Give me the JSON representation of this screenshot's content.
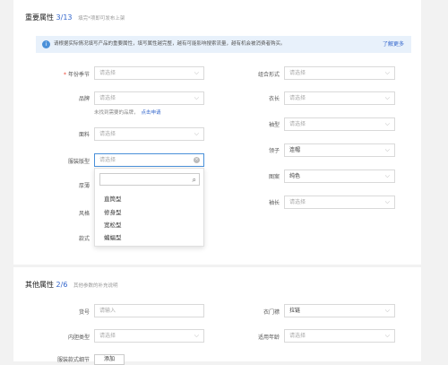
{
  "sections": {
    "important": {
      "title": "重要属性",
      "count": "3/13",
      "subtitle": "填完*项即可发布上架"
    },
    "other": {
      "title": "其他属性",
      "count": "2/6",
      "subtitle": "其他参数的补充说明"
    }
  },
  "notice": {
    "text": "请根据实际情况填写产品的重要属性，填写属性越完整，越有可能影响搜索流量，越有机会被消费者购买。",
    "more": "了解更多"
  },
  "placeholder": "请选择",
  "input_placeholder": "请输入",
  "fields_left": [
    {
      "label": "年份季节",
      "required": "*",
      "value": "请选择"
    },
    {
      "label": "品牌",
      "value": "请选择"
    },
    {
      "label": "面料",
      "value": "请选择"
    },
    {
      "label": "服装版型",
      "value": "请选择"
    },
    {
      "label": "厚薄",
      "value": ""
    },
    {
      "label": "风格",
      "value": ""
    },
    {
      "label": "款式",
      "value": ""
    }
  ],
  "brand_hint": {
    "text": "未找到需要的品牌，",
    "link": "点击申请"
  },
  "fields_right": [
    {
      "label": "组合形式",
      "value": "请选择"
    },
    {
      "label": "衣长",
      "value": "请选择"
    },
    {
      "label": "袖型",
      "value": "请选择"
    },
    {
      "label": "领子",
      "value": "连帽"
    },
    {
      "label": "图案",
      "value": "纯色"
    },
    {
      "label": "袖长",
      "value": "请选择"
    }
  ],
  "dropdown": {
    "options": [
      "直筒型",
      "修身型",
      "宽松型",
      "蝙蝠型"
    ]
  },
  "other_fields": [
    {
      "label": "货号",
      "value": "请输入"
    },
    {
      "label": "衣门襟",
      "value": "拉链"
    },
    {
      "label": "内胆类型",
      "value": "请选择"
    },
    {
      "label": "适用年龄",
      "value": "请选择"
    },
    {
      "label": "服装款式细节",
      "value": ""
    }
  ],
  "other_button": "添加"
}
